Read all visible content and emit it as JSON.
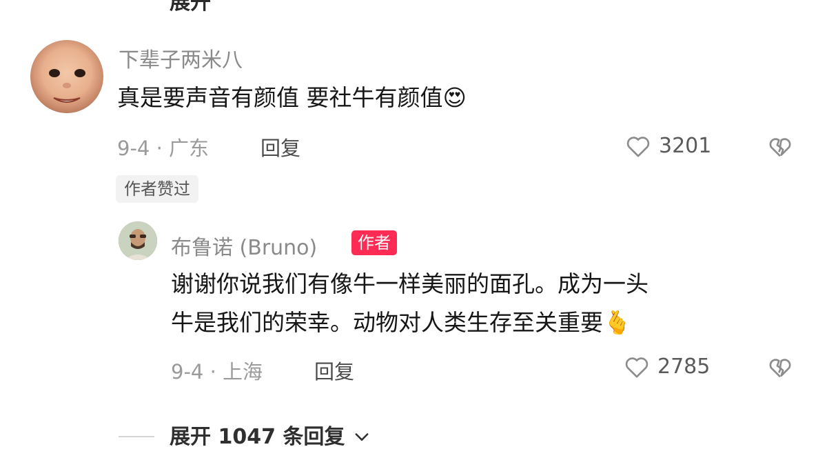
{
  "top_expand": {
    "label": "展开"
  },
  "comment": {
    "username": "下辈子两米八",
    "text": "真是要声音有颜值 要社牛有颜值😍",
    "date_location": "9-4 · 广东",
    "reply_label": "回复",
    "like_count": "3201",
    "author_liked_badge": "作者赞过"
  },
  "reply": {
    "username": "布鲁诺 (Bruno)",
    "author_badge": "作者",
    "text_line1": "谢谢你说我们有像牛一样美丽的面孔。成为一头",
    "text_line2": "牛是我们的荣幸。动物对人类生存至关重要🫰",
    "date_location": "9-4 · 上海",
    "reply_label": "回复",
    "like_count": "2785"
  },
  "expand_more": {
    "label": "展开 1047 条回复"
  },
  "icons": {
    "like": "heart-outline-icon",
    "dislike": "broken-heart-icon",
    "expand": "chevron-down-icon"
  },
  "colors": {
    "author_badge_bg": "#fe2c55",
    "text_primary": "#161616",
    "text_secondary": "#9a9a9a"
  }
}
